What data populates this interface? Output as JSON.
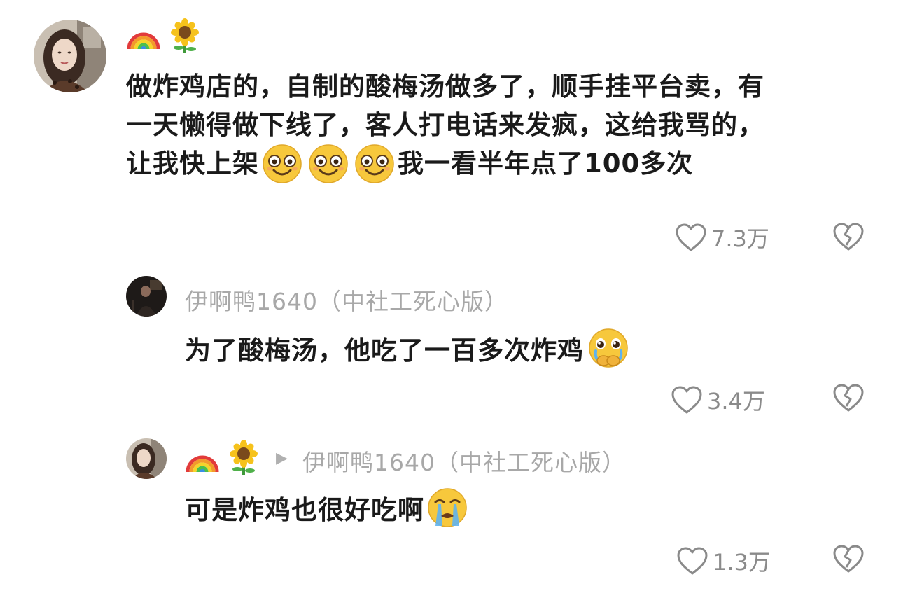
{
  "comment": {
    "author_badges": [
      "rainbow-icon",
      "sunflower-icon"
    ],
    "text_lines": [
      "做炸鸡店的，自制的酸梅汤做多了，顺手挂平台卖，有",
      "一天懒得做下线了，客人打电话来发疯，这给我骂的，",
      "让我快上架"
    ],
    "text_tail": "我一看半年点了100多次",
    "inline_emojis": [
      "smile-emoji",
      "smile-emoji",
      "smile-emoji"
    ],
    "likes": "7.3万"
  },
  "reply1": {
    "username": "伊啊鸭1640（中社工死心版）",
    "text": "为了酸梅汤，他吃了一百多次炸鸡",
    "emoji": "pleading-cry-emoji",
    "likes": "3.4万"
  },
  "reply2": {
    "author_badges": [
      "rainbow-icon",
      "sunflower-icon"
    ],
    "reply_to": "伊啊鸭1640（中社工死心版）",
    "text": "可是炸鸡也很好吃啊",
    "emoji": "crying-emoji",
    "likes": "1.3万"
  },
  "colors": {
    "text": "#1a1a1a",
    "muted": "#a8a8a8",
    "icon": "#8a8a8a"
  }
}
